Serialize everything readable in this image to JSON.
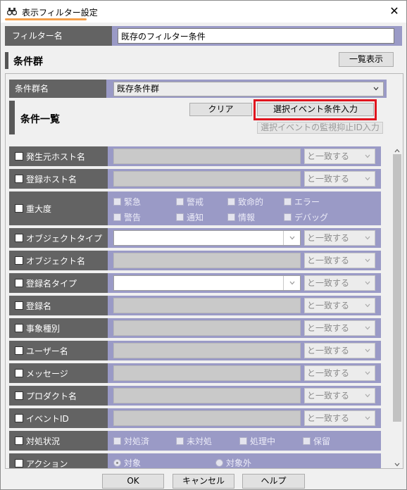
{
  "window": {
    "title": "表示フィルター設定",
    "close_label": "✕"
  },
  "filter_name": {
    "label": "フィルター名",
    "value": "既存のフィルター条件"
  },
  "condition_group": {
    "heading": "条件群",
    "list_view_button": "一覧表示",
    "name_label": "条件群名",
    "name_value": "既存条件群"
  },
  "condition_list": {
    "heading": "条件一覧",
    "clear_button": "クリア",
    "select_event_button": "選択イベント条件入力",
    "suppress_id_button": "選択イベントの監視抑止ID入力"
  },
  "conditions": [
    {
      "label": "発生元ホスト名",
      "match": "と一致する"
    },
    {
      "label": "登録ホスト名",
      "match": "と一致する"
    },
    {
      "label": "重大度",
      "options": [
        "緊急",
        "警戒",
        "致命的",
        "エラー",
        "警告",
        "通知",
        "情報",
        "デバッグ"
      ]
    },
    {
      "label": "オブジェクトタイプ",
      "match": "と一致する"
    },
    {
      "label": "オブジェクト名",
      "match": "と一致する"
    },
    {
      "label": "登録名タイプ",
      "match": "と一致する"
    },
    {
      "label": "登録名",
      "match": "と一致する"
    },
    {
      "label": "事象種別",
      "match": "と一致する"
    },
    {
      "label": "ユーザー名",
      "match": "と一致する"
    },
    {
      "label": "メッセージ",
      "match": "と一致する"
    },
    {
      "label": "プロダクト名",
      "match": "と一致する"
    },
    {
      "label": "イベントID",
      "match": "と一致する"
    },
    {
      "label": "対処状況",
      "options": [
        "対処済",
        "未対処",
        "処理中",
        "保留"
      ]
    },
    {
      "label": "アクション",
      "radios": [
        "対象",
        "対象外"
      ]
    }
  ],
  "footer": {
    "ok": "OK",
    "cancel": "キャンセル",
    "help": "ヘルプ"
  },
  "colors": {
    "label_bg": "#636363",
    "row_bg": "#9a9ac6",
    "highlight": "#e0141e",
    "title_underline": "#f5a04a"
  }
}
